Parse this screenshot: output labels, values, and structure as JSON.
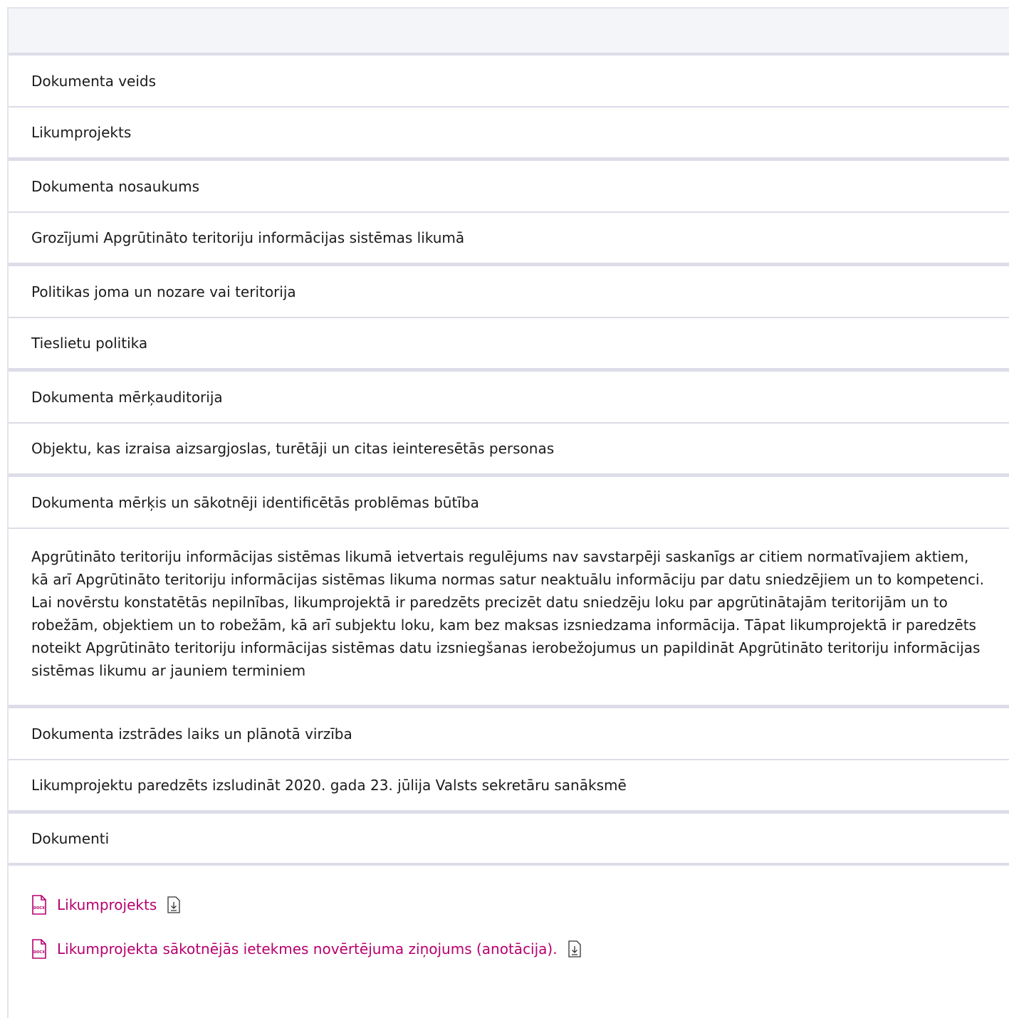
{
  "rows": {
    "type_label": "Dokumenta veids",
    "type_value": "Likumprojekts",
    "title_label": "Dokumenta nosaukums",
    "title_value": "Grozījumi Apgrūtināto teritoriju informācijas sistēmas likumā",
    "policy_label": "Politikas joma un nozare vai teritorija",
    "policy_value": "Tieslietu politika",
    "audience_label": "Dokumenta mērķauditorija",
    "audience_value": "Objektu, kas izraisa aizsargjoslas, turētāji un citas ieinteresētās personas",
    "purpose_label": "Dokumenta mērķis un sākotnēji identificētās problēmas būtība",
    "purpose_value": "Apgrūtināto teritoriju informācijas sistēmas likumā ietvertais regulējums nav savstarpēji saskanīgs ar citiem normatīvajiem aktiem, kā arī Apgrūtināto teritoriju informācijas sistēmas likuma normas satur neaktuālu informāciju par datu sniedzējiem un to kompetenci. Lai novērstu konstatētās nepilnības, likumprojektā ir paredzēts precizēt datu sniedzēju loku par apgrūtinātajām teritorijām un to robežām, objektiem un to robežām, kā arī subjektu loku, kam bez maksas izsniedzama informācija. Tāpat likumprojektā ir paredzēts noteikt Apgrūtināto teritoriju informācijas sistēmas datu izsniegšanas ierobežojumus un papildināt Apgrūtināto teritoriju informācijas sistēmas likumu ar jauniem terminiem",
    "timeline_label": "Dokumenta izstrādes laiks un plānotā virzība",
    "timeline_value": "Likumprojektu paredzēts izsludināt 2020. gada 23. jūlija Valsts sekretāru sanāksmē",
    "documents_label": "Dokumenti"
  },
  "documents": [
    {
      "name": "Likumprojekts",
      "file_type": "DOCX"
    },
    {
      "name": "Likumprojekta sākotnējās ietekmes novērtējuma ziņojums (anotācija).",
      "file_type": "DOCX"
    }
  ],
  "colors": {
    "link": "#b5006e",
    "border": "#dcdde8",
    "header_bg": "#f4f5f8"
  },
  "icons": {
    "doc": "docx-file-icon",
    "download": "download-icon"
  }
}
